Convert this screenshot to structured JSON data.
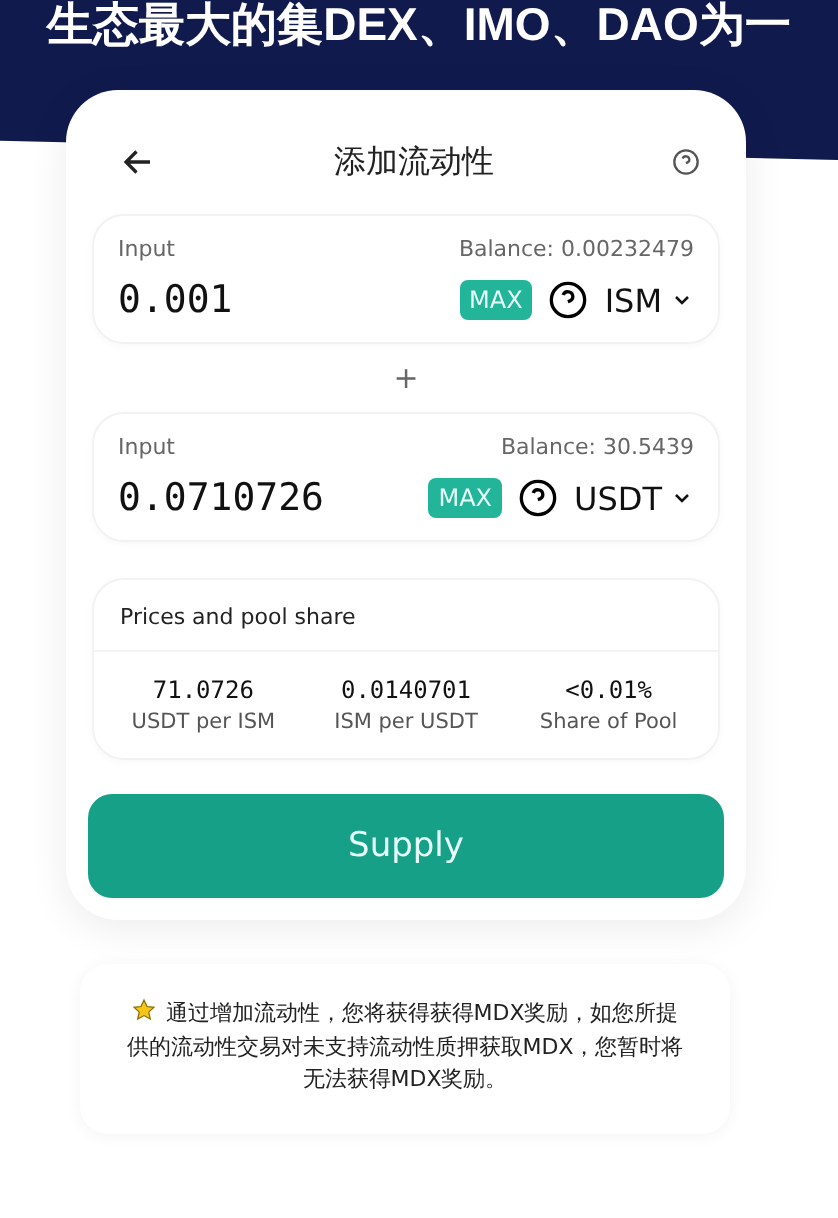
{
  "banner": {
    "headline": "生态最大的集DEX、IMO、DAO为一"
  },
  "card": {
    "title": "添加流动性",
    "inputs": [
      {
        "label": "Input",
        "balance": "Balance: 0.00232479",
        "value": "0.001",
        "max": "MAX",
        "token": "ISM"
      },
      {
        "label": "Input",
        "balance": "Balance: 30.5439",
        "value": "0.0710726",
        "max": "MAX",
        "token": "USDT"
      }
    ],
    "plus": "+",
    "prices": {
      "title": "Prices and pool share",
      "stats": [
        {
          "value": "71.0726",
          "label": "USDT per ISM"
        },
        {
          "value": "0.0140701",
          "label": "ISM per USDT"
        },
        {
          "value": "<0.01%",
          "label": "Share of Pool"
        }
      ]
    },
    "supply": "Supply"
  },
  "notice": "通过增加流动性，您将获得获得MDX奖励，如您所提供的流动性交易对未支持流动性质押获取MDX，您暂时将无法获得MDX奖励。"
}
